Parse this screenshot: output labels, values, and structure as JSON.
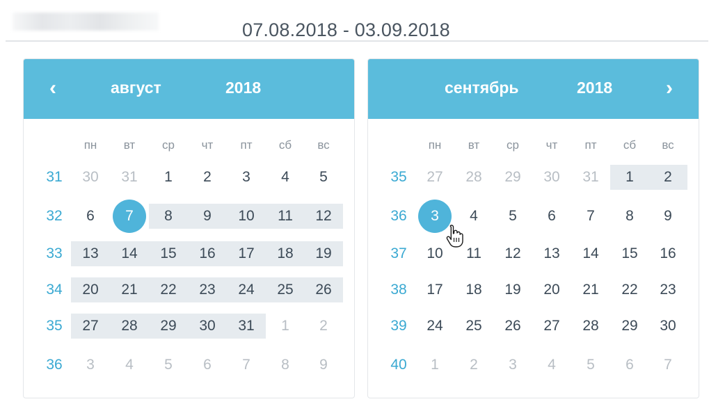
{
  "range_field": {
    "value": "07.08.2018 - 03.09.2018"
  },
  "calendars": [
    {
      "month": "август",
      "year": "2018",
      "nav": "‹",
      "dow": [
        "пн",
        "вт",
        "ср",
        "чт",
        "пт",
        "сб",
        "вс"
      ],
      "weeks": [
        {
          "num": "31",
          "days": [
            "30",
            "31",
            "1",
            "2",
            "3",
            "4",
            "5"
          ],
          "muted": [
            true,
            true,
            false,
            false,
            false,
            false,
            false
          ]
        },
        {
          "num": "32",
          "days": [
            "6",
            "7",
            "8",
            "9",
            "10",
            "11",
            "12"
          ],
          "muted": [
            false,
            false,
            false,
            false,
            false,
            false,
            false
          ]
        },
        {
          "num": "33",
          "days": [
            "13",
            "14",
            "15",
            "16",
            "17",
            "18",
            "19"
          ],
          "muted": [
            false,
            false,
            false,
            false,
            false,
            false,
            false
          ]
        },
        {
          "num": "34",
          "days": [
            "20",
            "21",
            "22",
            "23",
            "24",
            "25",
            "26"
          ],
          "muted": [
            false,
            false,
            false,
            false,
            false,
            false,
            false
          ]
        },
        {
          "num": "35",
          "days": [
            "27",
            "28",
            "29",
            "30",
            "31",
            "1",
            "2"
          ],
          "muted": [
            false,
            false,
            false,
            false,
            false,
            true,
            true
          ]
        },
        {
          "num": "36",
          "days": [
            "3",
            "4",
            "5",
            "6",
            "7",
            "8",
            "9"
          ],
          "muted": [
            true,
            true,
            true,
            true,
            true,
            true,
            true
          ]
        }
      ],
      "selected_day": "7"
    },
    {
      "month": "сентябрь",
      "year": "2018",
      "nav": "›",
      "dow": [
        "пн",
        "вт",
        "ср",
        "чт",
        "пт",
        "сб",
        "вс"
      ],
      "weeks": [
        {
          "num": "35",
          "days": [
            "27",
            "28",
            "29",
            "30",
            "31",
            "1",
            "2"
          ],
          "muted": [
            true,
            true,
            true,
            true,
            true,
            false,
            false
          ]
        },
        {
          "num": "36",
          "days": [
            "3",
            "4",
            "5",
            "6",
            "7",
            "8",
            "9"
          ],
          "muted": [
            false,
            false,
            false,
            false,
            false,
            false,
            false
          ]
        },
        {
          "num": "37",
          "days": [
            "10",
            "11",
            "12",
            "13",
            "14",
            "15",
            "16"
          ],
          "muted": [
            false,
            false,
            false,
            false,
            false,
            false,
            false
          ]
        },
        {
          "num": "38",
          "days": [
            "17",
            "18",
            "19",
            "20",
            "21",
            "22",
            "23"
          ],
          "muted": [
            false,
            false,
            false,
            false,
            false,
            false,
            false
          ]
        },
        {
          "num": "39",
          "days": [
            "24",
            "25",
            "26",
            "27",
            "28",
            "29",
            "30"
          ],
          "muted": [
            false,
            false,
            false,
            false,
            false,
            false,
            false
          ]
        },
        {
          "num": "40",
          "days": [
            "1",
            "2",
            "3",
            "4",
            "5",
            "6",
            "7"
          ],
          "muted": [
            true,
            true,
            true,
            true,
            true,
            true,
            true
          ]
        }
      ],
      "selected_day": "3"
    }
  ],
  "colors": {
    "header": "#5bbcdc",
    "selected": "#4fb4da",
    "range_band": "#e6ebef",
    "week_number": "#3aa9d2",
    "muted_day": "#b8bec4"
  },
  "icons": {
    "prev": "chevron-left-icon",
    "next": "chevron-right-icon",
    "cursor": "hand-pointer-icon"
  }
}
